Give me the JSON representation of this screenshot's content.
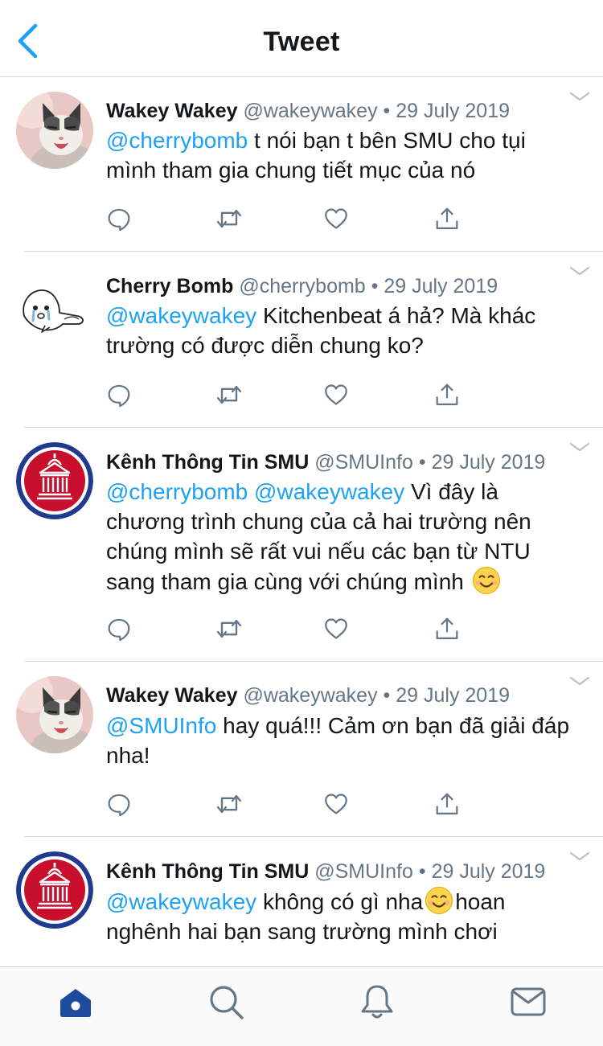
{
  "header": {
    "title": "Tweet",
    "back_icon": "chevron-left-icon"
  },
  "colors": {
    "accent": "#1da1f2",
    "secondary_text": "#657786",
    "icon_gray": "#657786",
    "active_tab": "#1d4ba0",
    "smu_red": "#c8102e"
  },
  "tweets": [
    {
      "name": "Wakey Wakey",
      "handle": "@wakeywakey",
      "separator": "•",
      "date": "29 July 2019",
      "avatar": "cat-avatar",
      "mentions": [
        "@cherrybomb"
      ],
      "text": "t nói bạn t bên SMU cho tụi mình tham gia chung tiết mục của nó"
    },
    {
      "name": "Cherry Bomb",
      "handle": "@cherrybomb",
      "separator": "•",
      "date": "29 July 2019",
      "avatar": "crying-seal-avatar",
      "mentions": [
        "@wakeywakey"
      ],
      "text": "Kitchenbeat á hả? Mà khác trường có được diễn chung ko?"
    },
    {
      "name": "Kênh Thông Tin SMU",
      "handle": "@SMUInfo",
      "separator": "•",
      "date": "29 July 2019",
      "avatar": "smu-seal-avatar",
      "mentions": [
        "@cherrybomb",
        "@wakeywakey"
      ],
      "text": "Vì đây là chương trình chung của cả hai trường nên chúng mình sẽ rất vui nếu các bạn từ NTU sang tham gia cùng với chúng mình",
      "emoji": "smiling-face-emoji"
    },
    {
      "name": "Wakey Wakey",
      "handle": "@wakeywakey",
      "separator": "•",
      "date": "29 July 2019",
      "avatar": "cat-avatar",
      "mentions": [
        "@SMUInfo"
      ],
      "text": "hay quá!!! Cảm ơn bạn đã giải đáp nha!"
    },
    {
      "name": "Kênh Thông Tin SMU",
      "handle": "@SMUInfo",
      "separator": "•",
      "date": "29 July 2019",
      "avatar": "smu-seal-avatar",
      "mentions": [
        "@wakeywakey"
      ],
      "text_before_emoji": "không có gì nha",
      "emoji": "smiling-face-emoji",
      "text_after_emoji": "hoan nghênh hai bạn sang trường mình chơi"
    }
  ],
  "actions": [
    "reply-icon",
    "retweet-icon",
    "like-icon",
    "share-icon"
  ],
  "tabbar": {
    "items": [
      "home-icon",
      "search-icon",
      "notifications-icon",
      "messages-icon"
    ],
    "active": "home-icon"
  }
}
